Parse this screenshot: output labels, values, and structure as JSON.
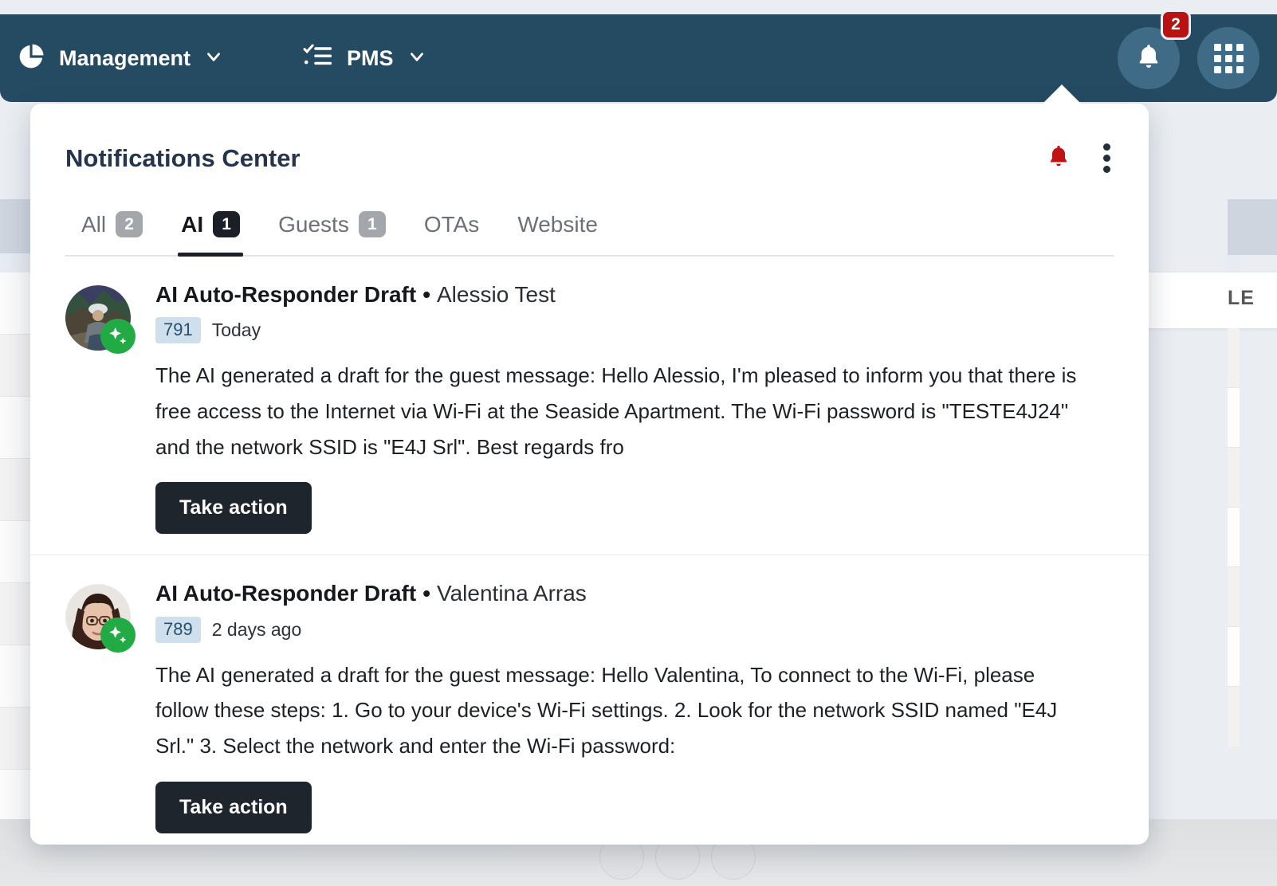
{
  "navbar": {
    "background_color": "#254b63",
    "items": [
      {
        "icon": "pie-chart-icon",
        "label": "Management",
        "chevron": "chevron-down-icon"
      },
      {
        "icon": "checklist-icon",
        "label": "PMS",
        "chevron": "chevron-down-icon"
      }
    ],
    "notifications_button": {
      "icon": "bell-icon",
      "badge_count": "2",
      "badge_color": "#b91212"
    },
    "apps_button": {
      "icon": "grid-apps-icon"
    }
  },
  "popup": {
    "title": "Notifications Center",
    "header_actions": [
      {
        "icon": "bell-alert-icon",
        "color": "#c01313"
      },
      {
        "icon": "more-vertical-icon"
      }
    ],
    "tabs": [
      {
        "label": "All",
        "badge": "2",
        "active": false
      },
      {
        "label": "AI",
        "badge": "1",
        "active": true
      },
      {
        "label": "Guests",
        "badge": "1",
        "active": false
      },
      {
        "label": "OTAs",
        "badge": "",
        "active": false
      },
      {
        "label": "Website",
        "badge": "",
        "active": false
      }
    ],
    "notifications": [
      {
        "type": "AI Auto-Responder Draft",
        "separator": "•",
        "guest": "Alessio Test",
        "id": "791",
        "time": "Today",
        "text": "The AI generated a draft for the guest message: Hello Alessio, I'm pleased to inform you that there is free access to the Internet via Wi-Fi at the Seaside Apartment. The Wi-Fi password is \"TESTE4J24\" and the network SSID is \"E4J Srl\". Best regards fro",
        "action_label": "Take action",
        "avatar": "photo-man-outdoors",
        "badge_icon": "ai-sparkle-icon"
      },
      {
        "type": "AI Auto-Responder Draft",
        "separator": "•",
        "guest": "Valentina Arras",
        "id": "789",
        "time": "2 days ago",
        "text": "The AI generated a draft for the guest message: Hello Valentina, To connect to the Wi-Fi, please follow these steps: 1. Go to your device's Wi-Fi settings. 2. Look for the network SSID named \"E4J Srl.\" 3. Select the network and enter the Wi-Fi password:",
        "action_label": "Take action",
        "avatar": "photo-woman-glasses",
        "badge_icon": "ai-sparkle-icon"
      }
    ]
  },
  "background": {
    "card_title": "LE"
  }
}
